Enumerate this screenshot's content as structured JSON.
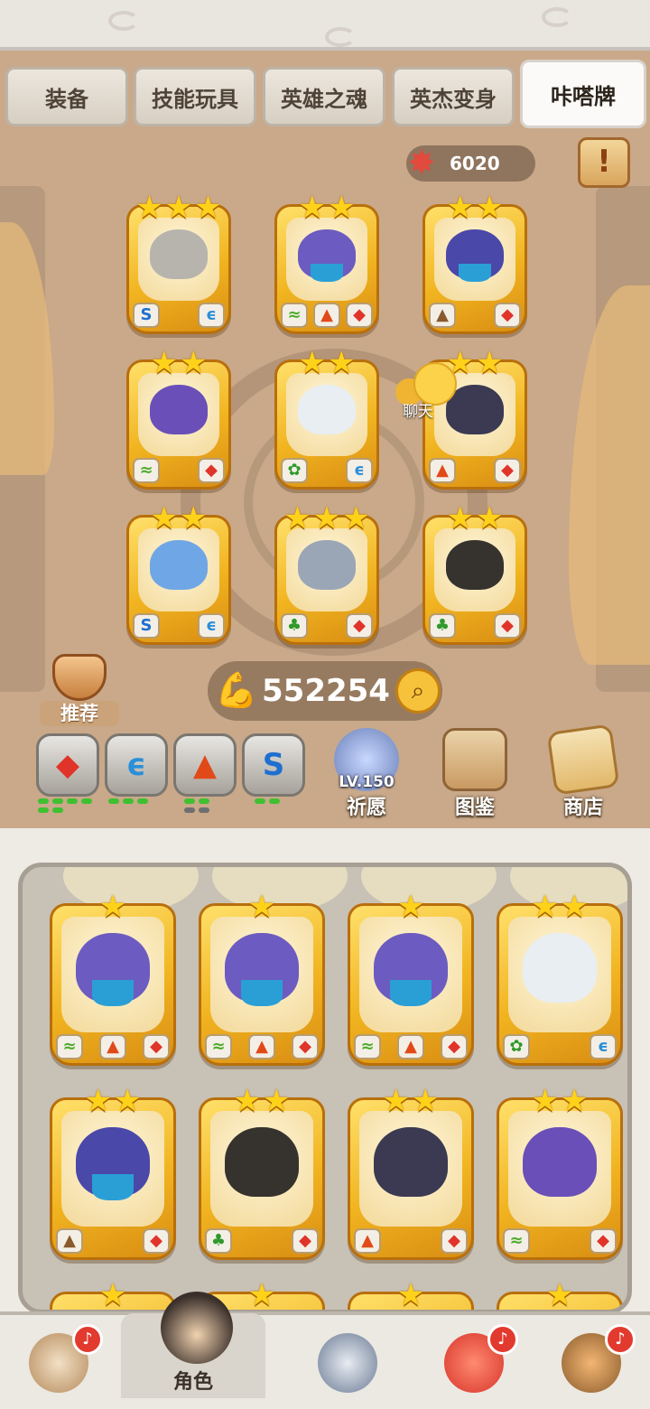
{
  "tabs": [
    {
      "label": "装备"
    },
    {
      "label": "技能玩具"
    },
    {
      "label": "英雄之魂"
    },
    {
      "label": "英杰变身"
    },
    {
      "label": "咔嗒牌",
      "active": true
    }
  ],
  "currency": {
    "star_value": "6020",
    "star_icon": "starfish-icon"
  },
  "quest_icon": "exclamation-scroll-icon",
  "chat": {
    "label": "聊天"
  },
  "recommend": {
    "label": "推荐"
  },
  "power": {
    "value": "552254",
    "icon": "flexed-arm-icon"
  },
  "elements": [
    {
      "name": "rock",
      "level_pips": 6
    },
    {
      "name": "wind",
      "level_pips": 3
    },
    {
      "name": "mountain",
      "level_pips": 2
    },
    {
      "name": "water",
      "level_pips": 2
    }
  ],
  "features": [
    {
      "label": "祈愿",
      "sub": "LV.150"
    },
    {
      "label": "图鉴"
    },
    {
      "label": "商店"
    }
  ],
  "bottom_nav": [
    {
      "label": "",
      "icon": "caveman-icon",
      "alert": true
    },
    {
      "label": "角色",
      "icon": "hero-icon",
      "active": true
    },
    {
      "label": "",
      "icon": "sword-shield-icon",
      "alert": false
    },
    {
      "label": "",
      "icon": "red-dino-icon",
      "alert": true
    },
    {
      "label": "",
      "icon": "tiki-monster-icon",
      "alert": true
    }
  ]
}
